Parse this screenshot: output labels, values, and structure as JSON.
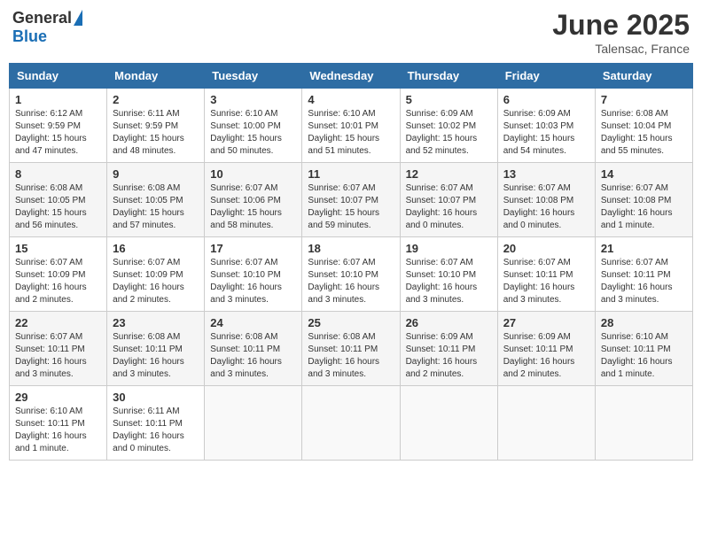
{
  "header": {
    "logo_general": "General",
    "logo_blue": "Blue",
    "month": "June 2025",
    "location": "Talensac, France"
  },
  "weekdays": [
    "Sunday",
    "Monday",
    "Tuesday",
    "Wednesday",
    "Thursday",
    "Friday",
    "Saturday"
  ],
  "weeks": [
    [
      {
        "day": "1",
        "info": "Sunrise: 6:12 AM\nSunset: 9:59 PM\nDaylight: 15 hours\nand 47 minutes."
      },
      {
        "day": "2",
        "info": "Sunrise: 6:11 AM\nSunset: 9:59 PM\nDaylight: 15 hours\nand 48 minutes."
      },
      {
        "day": "3",
        "info": "Sunrise: 6:10 AM\nSunset: 10:00 PM\nDaylight: 15 hours\nand 50 minutes."
      },
      {
        "day": "4",
        "info": "Sunrise: 6:10 AM\nSunset: 10:01 PM\nDaylight: 15 hours\nand 51 minutes."
      },
      {
        "day": "5",
        "info": "Sunrise: 6:09 AM\nSunset: 10:02 PM\nDaylight: 15 hours\nand 52 minutes."
      },
      {
        "day": "6",
        "info": "Sunrise: 6:09 AM\nSunset: 10:03 PM\nDaylight: 15 hours\nand 54 minutes."
      },
      {
        "day": "7",
        "info": "Sunrise: 6:08 AM\nSunset: 10:04 PM\nDaylight: 15 hours\nand 55 minutes."
      }
    ],
    [
      {
        "day": "8",
        "info": "Sunrise: 6:08 AM\nSunset: 10:05 PM\nDaylight: 15 hours\nand 56 minutes."
      },
      {
        "day": "9",
        "info": "Sunrise: 6:08 AM\nSunset: 10:05 PM\nDaylight: 15 hours\nand 57 minutes."
      },
      {
        "day": "10",
        "info": "Sunrise: 6:07 AM\nSunset: 10:06 PM\nDaylight: 15 hours\nand 58 minutes."
      },
      {
        "day": "11",
        "info": "Sunrise: 6:07 AM\nSunset: 10:07 PM\nDaylight: 15 hours\nand 59 minutes."
      },
      {
        "day": "12",
        "info": "Sunrise: 6:07 AM\nSunset: 10:07 PM\nDaylight: 16 hours\nand 0 minutes."
      },
      {
        "day": "13",
        "info": "Sunrise: 6:07 AM\nSunset: 10:08 PM\nDaylight: 16 hours\nand 0 minutes."
      },
      {
        "day": "14",
        "info": "Sunrise: 6:07 AM\nSunset: 10:08 PM\nDaylight: 16 hours\nand 1 minute."
      }
    ],
    [
      {
        "day": "15",
        "info": "Sunrise: 6:07 AM\nSunset: 10:09 PM\nDaylight: 16 hours\nand 2 minutes."
      },
      {
        "day": "16",
        "info": "Sunrise: 6:07 AM\nSunset: 10:09 PM\nDaylight: 16 hours\nand 2 minutes."
      },
      {
        "day": "17",
        "info": "Sunrise: 6:07 AM\nSunset: 10:10 PM\nDaylight: 16 hours\nand 3 minutes."
      },
      {
        "day": "18",
        "info": "Sunrise: 6:07 AM\nSunset: 10:10 PM\nDaylight: 16 hours\nand 3 minutes."
      },
      {
        "day": "19",
        "info": "Sunrise: 6:07 AM\nSunset: 10:10 PM\nDaylight: 16 hours\nand 3 minutes."
      },
      {
        "day": "20",
        "info": "Sunrise: 6:07 AM\nSunset: 10:11 PM\nDaylight: 16 hours\nand 3 minutes."
      },
      {
        "day": "21",
        "info": "Sunrise: 6:07 AM\nSunset: 10:11 PM\nDaylight: 16 hours\nand 3 minutes."
      }
    ],
    [
      {
        "day": "22",
        "info": "Sunrise: 6:07 AM\nSunset: 10:11 PM\nDaylight: 16 hours\nand 3 minutes."
      },
      {
        "day": "23",
        "info": "Sunrise: 6:08 AM\nSunset: 10:11 PM\nDaylight: 16 hours\nand 3 minutes."
      },
      {
        "day": "24",
        "info": "Sunrise: 6:08 AM\nSunset: 10:11 PM\nDaylight: 16 hours\nand 3 minutes."
      },
      {
        "day": "25",
        "info": "Sunrise: 6:08 AM\nSunset: 10:11 PM\nDaylight: 16 hours\nand 3 minutes."
      },
      {
        "day": "26",
        "info": "Sunrise: 6:09 AM\nSunset: 10:11 PM\nDaylight: 16 hours\nand 2 minutes."
      },
      {
        "day": "27",
        "info": "Sunrise: 6:09 AM\nSunset: 10:11 PM\nDaylight: 16 hours\nand 2 minutes."
      },
      {
        "day": "28",
        "info": "Sunrise: 6:10 AM\nSunset: 10:11 PM\nDaylight: 16 hours\nand 1 minute."
      }
    ],
    [
      {
        "day": "29",
        "info": "Sunrise: 6:10 AM\nSunset: 10:11 PM\nDaylight: 16 hours\nand 1 minute."
      },
      {
        "day": "30",
        "info": "Sunrise: 6:11 AM\nSunset: 10:11 PM\nDaylight: 16 hours\nand 0 minutes."
      },
      {
        "day": "",
        "info": ""
      },
      {
        "day": "",
        "info": ""
      },
      {
        "day": "",
        "info": ""
      },
      {
        "day": "",
        "info": ""
      },
      {
        "day": "",
        "info": ""
      }
    ]
  ]
}
